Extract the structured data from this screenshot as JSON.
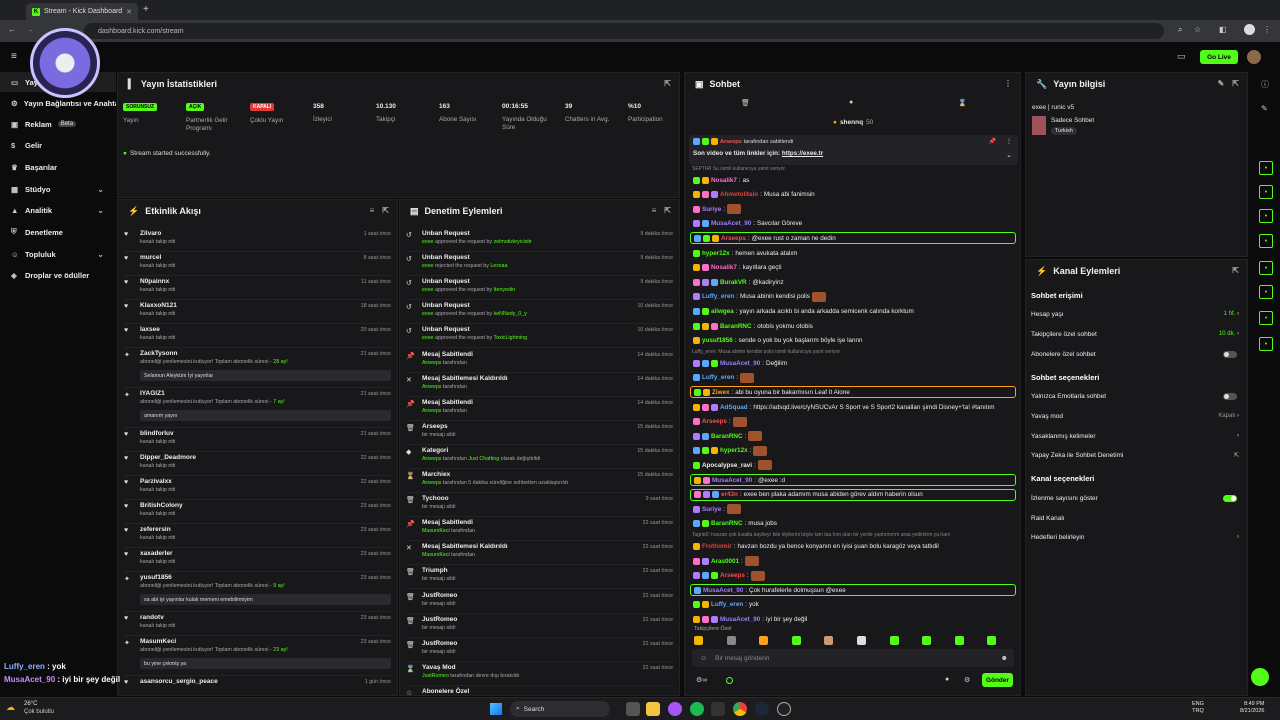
{
  "browser": {
    "tab_title": "Stream - Kick Dashboard",
    "url": "dashboard.kick.com/stream",
    "go_live": "Go Live"
  },
  "sidebar": {
    "items": [
      {
        "label": "Yayın",
        "has_chevron": false
      },
      {
        "label": "Yayın Bağlantısı ve Anahtarı",
        "has_chevron": false
      },
      {
        "label": "Reklam",
        "badge": "Beta",
        "has_chevron": false
      },
      {
        "label": "Gelir",
        "has_chevron": false
      },
      {
        "label": "Başarılar",
        "has_chevron": false
      },
      {
        "label": "Stüdyo",
        "has_chevron": true
      },
      {
        "label": "Analitik",
        "has_chevron": true
      },
      {
        "label": "Denetleme",
        "has_chevron": false
      },
      {
        "label": "Topluluk",
        "has_chevron": true
      },
      {
        "label": "Droplar ve ödüller",
        "has_chevron": false
      }
    ]
  },
  "stats": {
    "title": "Yayın İstatistikleri",
    "items": [
      {
        "value": "SORUNSUZ",
        "label": "Yayın",
        "pill": "green"
      },
      {
        "value": "AÇIK",
        "label": "Partnerlik Gelir Programı",
        "pill": "green"
      },
      {
        "value": "KAPALI",
        "label": "Çoklu Yayın",
        "pill": "red"
      },
      {
        "value": "358",
        "label": "İzleyici"
      },
      {
        "value": "10.130",
        "label": "Takipçi"
      },
      {
        "value": "163",
        "label": "Abone Sayısı"
      },
      {
        "value": "00:16:55",
        "label": "Yayında Olduğu Süre"
      },
      {
        "value": "39",
        "label": "Chatters in Avg."
      },
      {
        "value": "%10",
        "label": "Participation"
      }
    ],
    "success": "Stream started successfully."
  },
  "activity": {
    "title": "Etkinlik Akışı",
    "rows": [
      {
        "name": "Zilvaro",
        "sub": "kanalı takip etti",
        "time": "1 saat önce",
        "icon": "heart"
      },
      {
        "name": "murcel",
        "sub": "kanalı takip etti",
        "time": "8 saat önce",
        "icon": "heart"
      },
      {
        "name": "N0painnx",
        "sub": "kanalı takip etti",
        "time": "11 saat önce",
        "icon": "heart"
      },
      {
        "name": "KlaxxoN121",
        "sub": "kanalı takip etti",
        "time": "18 saat önce",
        "icon": "heart"
      },
      {
        "name": "Iaxsee",
        "sub": "kanalı takip etti",
        "time": "20 saat önce",
        "icon": "heart"
      },
      {
        "name": "ZackTysonn",
        "sub": "aboneliği yenilemesini kutluyor! Toplam abonelik süresi - ",
        "sub_hl": "28 ay!",
        "time": "21 saat önce",
        "icon": "sub",
        "msg": "Selamun Aleyküm İyi yayınlar"
      },
      {
        "name": "IYAGIZ1",
        "sub": "aboneliği yenilemesini kutluyor! Toplam abonelik süresi - ",
        "sub_hl": "7 ay!",
        "time": "21 saat önce",
        "icon": "sub",
        "msg": "amanım yayın"
      },
      {
        "name": "blindforluv",
        "sub": "kanalı takip etti",
        "time": "21 saat önce",
        "icon": "heart"
      },
      {
        "name": "Dipper_Deadmore",
        "sub": "kanalı takip etti",
        "time": "22 saat önce",
        "icon": "heart"
      },
      {
        "name": "Parzivalxx",
        "sub": "kanalı takip etti",
        "time": "22 saat önce",
        "icon": "heart"
      },
      {
        "name": "BritishColony",
        "sub": "kanalı takip etti",
        "time": "23 saat önce",
        "icon": "heart"
      },
      {
        "name": "zeferersin",
        "sub": "kanalı takip etti",
        "time": "23 saat önce",
        "icon": "heart"
      },
      {
        "name": "xaxaderler",
        "sub": "kanalı takip etti",
        "time": "23 saat önce",
        "icon": "heart"
      },
      {
        "name": "yusuf1856",
        "sub": "aboneliği yenilemesini kutluyor! Toplam abonelik süresi - ",
        "sub_hl": "9 ay!",
        "time": "23 saat önce",
        "icon": "sub",
        "msg": "sa abi iyi yayınlar kulak memeni emebilirmiyim"
      },
      {
        "name": "randotv",
        "sub": "kanalı takip etti",
        "time": "23 saat önce",
        "icon": "heart"
      },
      {
        "name": "MasumKeci",
        "sub": "aboneliği yenilemesini kutluyor! Toplam abonelik süresi - ",
        "sub_hl": "23 ay!",
        "time": "23 saat önce",
        "icon": "sub",
        "msg": "bu yine çekmiş ya"
      },
      {
        "name": "asansorcu_sergio_peace",
        "sub": "",
        "time": "1 gün önce",
        "icon": "heart"
      }
    ]
  },
  "moderation": {
    "title": "Denetim Eylemleri",
    "rows": [
      {
        "name": "Unban Request",
        "who": "exee",
        "sub": " approved the request by ",
        "target": "zelmotizleyicisitr",
        "time": "9 dakika önce",
        "icon": "undo"
      },
      {
        "name": "Unban Request",
        "who": "exee",
        "sub": " rejected the request by ",
        "target": "Lexxaa",
        "time": "9 dakika önce",
        "icon": "undo"
      },
      {
        "name": "Unban Request",
        "who": "exee",
        "sub": " approved the request by ",
        "target": "Itenyedin",
        "time": "9 dakika önce",
        "icon": "undo"
      },
      {
        "name": "Unban Request",
        "who": "exee",
        "sub": " approved the request by ",
        "target": "keNNedy_0_y",
        "time": "10 dakika önce",
        "icon": "undo"
      },
      {
        "name": "Unban Request",
        "who": "exee",
        "sub": " approved the request by ",
        "target": "ToxicLightning",
        "time": "10 dakika önce",
        "icon": "undo"
      },
      {
        "name": "Mesaj Sabitlendi",
        "who": "Arseeps",
        "sub": " tarafından",
        "target": "",
        "time": "14 dakika önce",
        "icon": "pin"
      },
      {
        "name": "Mesaj Sabitlemesi Kaldırıldı",
        "who": "Arseeps",
        "sub": " tarafından",
        "target": "",
        "time": "14 dakika önce",
        "icon": "unpin"
      },
      {
        "name": "Mesaj Sabitlendi",
        "who": "Arseeps",
        "sub": " tarafından",
        "target": "",
        "time": "14 dakika önce",
        "icon": "pin"
      },
      {
        "name": "Arseeps",
        "who": "",
        "sub": "bir mesajı sildi",
        "target": "",
        "time": "15 dakika önce",
        "icon": "trash"
      },
      {
        "name": "Kategori",
        "who": "Arseeps",
        "sub": " tarafından ",
        "target": "Just Chatting",
        "tail": " olarak değiştirildi",
        "time": "15 dakika önce",
        "icon": "tag"
      },
      {
        "name": "Marchiex",
        "who": "Arseeps",
        "sub": " tarafından 5 dakika süreliğine sohbetten uzaklaştırıldı",
        "target": "",
        "time": "15 dakika önce",
        "icon": "timer"
      },
      {
        "name": "Tychooo",
        "who": "",
        "sub": "bir mesajı sildi",
        "target": "",
        "time": "9 saat önce",
        "icon": "trash"
      },
      {
        "name": "Mesaj Sabitlendi",
        "who": "MasumKeci",
        "sub": " tarafından",
        "target": "",
        "time": "22 saat önce",
        "icon": "pin"
      },
      {
        "name": "Mesaj Sabitlemesi Kaldırıldı",
        "who": "MasumKeci",
        "sub": " tarafından",
        "target": "",
        "time": "22 saat önce",
        "icon": "unpin"
      },
      {
        "name": "Triumph",
        "who": "",
        "sub": "bir mesajı sildi",
        "target": "",
        "time": "22 saat önce",
        "icon": "trash"
      },
      {
        "name": "JustRomeo",
        "who": "",
        "sub": "bir mesajı sildi",
        "target": "",
        "time": "22 saat önce",
        "icon": "trash"
      },
      {
        "name": "JustRomeo",
        "who": "",
        "sub": "bir mesajı sildi",
        "target": "",
        "time": "22 saat önce",
        "icon": "trash"
      },
      {
        "name": "JustRomeo",
        "who": "",
        "sub": "bir mesajı sildi",
        "target": "",
        "time": "22 saat önce",
        "icon": "trash"
      },
      {
        "name": "Yavaş Mod",
        "who": "JustRomeo",
        "sub": " tarafından devre dışı bırakıldı",
        "target": "",
        "time": "22 saat önce",
        "icon": "timer"
      },
      {
        "name": "Abonelere Özel",
        "who": "",
        "sub": "",
        "target": "",
        "time": "",
        "icon": "star"
      }
    ]
  },
  "chat": {
    "title": "Sohbet",
    "top_user": "shennq",
    "top_count": "50",
    "pinned_by": "Arseeps",
    "pinned_by_suffix": " tarafından sabitlendi",
    "pinned_text": "Son video ve tüm linkler için: ",
    "pinned_link": "https://exee.tr",
    "messages": [
      {
        "sys": "SEPTIRI Su isimli kullanıcıya yanıt veriyor"
      },
      {
        "user": "Nosalik7",
        "color": "#ff6ec7",
        "text": "as"
      },
      {
        "user": "Ahmetolitalo",
        "color": "#e04040",
        "text": "Musa abi fanimsin"
      },
      {
        "user": "Suriye",
        "color": "#b07cff",
        "text": "",
        "emote": true
      },
      {
        "user": "MusaAcet_90",
        "color": "#9f7dff",
        "text": "Savcılar Göreve"
      },
      {
        "user": "Arseeps",
        "color": "#ff4d4d",
        "text": "@exee rust o zaman ne dedin",
        "hl": true
      },
      {
        "user": "hyper12x",
        "color": "#53fc18",
        "text": "hemen avukata atalım"
      },
      {
        "user": "Nosalik7",
        "color": "#ff6ec7",
        "text": "kayıtlara geçti"
      },
      {
        "user": "BurakVR",
        "color": "#53fc18",
        "text": "@kadiryinz"
      },
      {
        "user": "Luffy_eren",
        "color": "#5aa9ff",
        "text": "Musa abinin kendisi polis",
        "emote": true
      },
      {
        "user": "aliwgea",
        "color": "#53fc18",
        "text": "yayın arkada acıktı bi anda arkadda semicenk calında korktum"
      },
      {
        "user": "BaranRNC",
        "color": "#53fc18",
        "text": "otobis yokmu otobis"
      },
      {
        "user": "yusuf1856",
        "color": "#53fc18",
        "text": "sende o yok bu yok başlarım böyle işe lannn"
      },
      {
        "sys": "Luffy_eren: Musa abinin kendisi polis isimli kullanıcıya yanıt veriyor"
      },
      {
        "user": "MusaAcet_90",
        "color": "#9f7dff",
        "text": "Değilim"
      },
      {
        "user": "Luffy_eren",
        "color": "#5aa9ff",
        "text": "",
        "emote": true
      },
      {
        "user": "Ziwex",
        "color": "#ff9f1a",
        "text": "abi bu oyuna bir bakarmısın Leaf It Alone",
        "hl": true,
        "hlcolor": "#ff9f1a"
      },
      {
        "user": "AdSquad",
        "color": "#5aa9ff",
        "text": "https://adsqd.live/c/yNSUCvAr S Sport ve S Sport2 kanalları şimdi Disney+'ta! #tanıtım"
      },
      {
        "user": "Arseeps",
        "color": "#ff4d4d",
        "text": "",
        "emote": true
      },
      {
        "user": "BaranRNC",
        "color": "#53fc18",
        "text": "",
        "emote": true
      },
      {
        "user": "hyper12x",
        "color": "#53fc18",
        "text": "",
        "emote": true
      },
      {
        "user": "Apocalypse_ravi",
        "color": "#eee",
        "text": "",
        "emote": true
      },
      {
        "user": "MusaAcet_90",
        "color": "#9f7dff",
        "text": "@exee :d",
        "hl": true
      },
      {
        "user": "er43n",
        "color": "#ff4d4d",
        "text": "exee ben plaka adamım musa abiden görev aldım haberin olsun",
        "hl": true
      },
      {
        "user": "Suriye",
        "color": "#b07cff",
        "text": "",
        "emote": true
      },
      {
        "user": "BaranRNC",
        "color": "#53fc18",
        "text": "musa jobs"
      },
      {
        "sys": "Tagrie0: havzan çok kısatla kaybeyr bile diyilerini böyle tam taa hım olan bir yerde yaptırmırım araa yedirtirim ya hani"
      },
      {
        "user": "Frothomir",
        "color": "#e04040",
        "text": "havzan bozdu ya bence konyanın en iyisi şuan bolu karagöz veya tatlıdil"
      },
      {
        "user": "Aras0001",
        "color": "#53fc18",
        "text": "",
        "emote": true
      },
      {
        "user": "Arseeps",
        "color": "#ff4d4d",
        "text": "",
        "emote": true
      },
      {
        "user": "MusaAcet_90",
        "color": "#9f7dff",
        "text": "Çok hurafelerle dolmuşsun @exee",
        "hl": true
      },
      {
        "user": "Luffy_eren",
        "color": "#5aa9ff",
        "text": "yok"
      },
      {
        "user": "MusaAcet_90",
        "color": "#9f7dff",
        "text": "iyi bir şey değil"
      }
    ],
    "emote_label": "Takipçilere Özel",
    "input_placeholder": "Bir mesaj gönderin",
    "send": "Gönder"
  },
  "stream_info": {
    "title": "Yayın bilgisi",
    "stream_title": "exee | runic v5",
    "chat_mode": "Sadece Sohbet",
    "language": "Turkish"
  },
  "channel_actions": {
    "title": "Kanal Eylemleri",
    "chat_access": "Sohbet erişimi",
    "access_rows": [
      {
        "label": "Hesap yaşı",
        "value": "1 hf."
      },
      {
        "label": "Takipçilere özel sohbet",
        "value": "10 dk."
      },
      {
        "label": "Abonelere özel sohbet",
        "toggle": false
      }
    ],
    "chat_options": "Sohbet seçenekleri",
    "option_rows": [
      {
        "label": "Yalnızca Emotlarla sohbet",
        "toggle": false
      },
      {
        "label": "Yavaş mod",
        "value": "Kapalı"
      },
      {
        "label": "Yasaklanmış kelimeler",
        "value": ""
      },
      {
        "label": "Yapay Zeka ile Sohbet Denetimi",
        "value": ""
      }
    ],
    "channel_options": "Kanal seçenekleri",
    "channel_rows": [
      {
        "label": "İzlenme sayısını göster",
        "toggle": true
      },
      {
        "label": "Raid Kanalı",
        "value": ""
      },
      {
        "label": "Hedefleri belirleyin",
        "value": ""
      }
    ]
  },
  "overlay": {
    "lines": [
      {
        "user": "Luffy_eren",
        "text": "yok"
      },
      {
        "user": "MusaAcet_90",
        "text": "iyi bir şey değil"
      }
    ]
  },
  "taskbar": {
    "temp": "26°C",
    "weather": "Çok bulutlu",
    "search": "Search",
    "lang1": "ENG",
    "lang2": "TRQ",
    "time": "8:49 PM",
    "date": "8/21/2026"
  }
}
